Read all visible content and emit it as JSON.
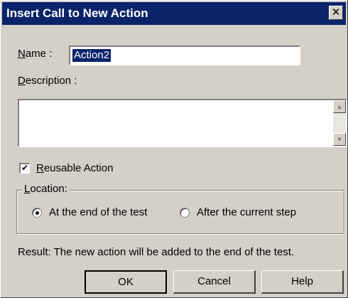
{
  "window": {
    "title": "Insert Call to New Action",
    "close_glyph": "✕"
  },
  "name": {
    "label_accel": "N",
    "label_rest": "ame :",
    "value": "Action2"
  },
  "description": {
    "label_accel": "D",
    "label_rest": "escription :",
    "value": ""
  },
  "reusable": {
    "label_accel": "R",
    "label_rest": "eusable Action",
    "checked": true,
    "check_glyph": "✔"
  },
  "location": {
    "legend_accel": "L",
    "legend_rest": "ocation:",
    "options": [
      {
        "label": "At the end of the test",
        "selected": true
      },
      {
        "label": "After the current step",
        "selected": false
      }
    ]
  },
  "result_text": "Result: The new action will be added to the end of the test.",
  "buttons": {
    "ok": "OK",
    "cancel": "Cancel",
    "help": "Help"
  },
  "icons": {
    "scroll_up": "up-arrow-icon",
    "scroll_down": "down-arrow-icon"
  }
}
